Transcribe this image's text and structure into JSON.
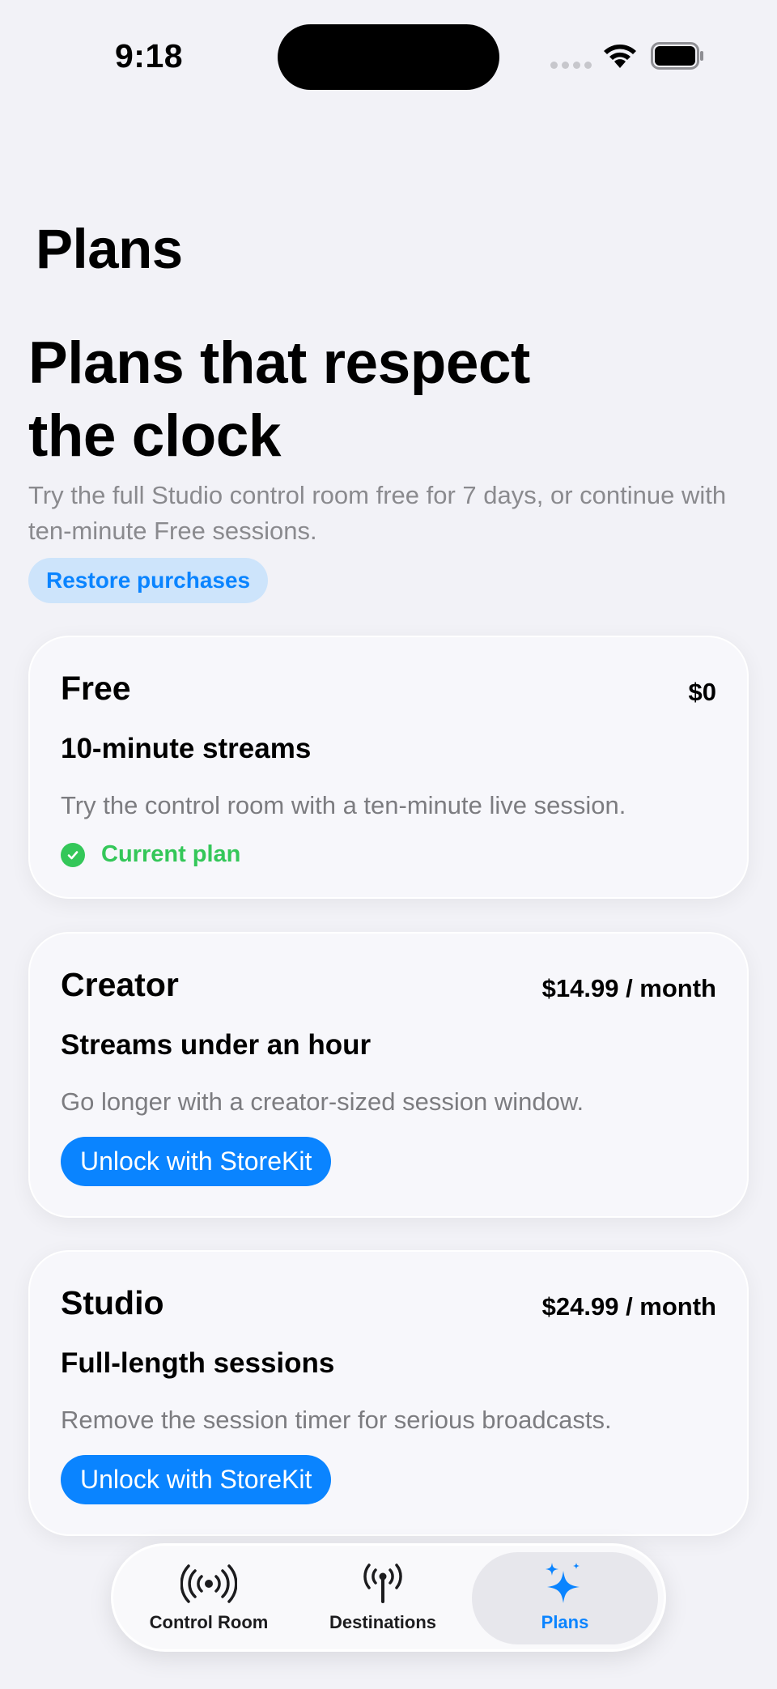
{
  "status_bar": {
    "time": "9:18"
  },
  "nav": {
    "title": "Plans"
  },
  "hero": {
    "title": "Plans that respect the clock",
    "subtitle": "Try the full Studio control room free for 7 days, or continue with ten-minute Free sessions.",
    "restore_label": "Restore purchases"
  },
  "plans": [
    {
      "name": "Free",
      "price": "$0",
      "headline": "10-minute streams",
      "description": "Try the control room with a ten-minute live session.",
      "status": "Current plan"
    },
    {
      "name": "Creator",
      "price": "$14.99 / month",
      "headline": "Streams under an hour",
      "description": "Go longer with a creator-sized session window.",
      "action": "Unlock with StoreKit"
    },
    {
      "name": "Studio",
      "price": "$24.99 / month",
      "headline": "Full-length sessions",
      "description": "Remove the session timer for serious broadcasts.",
      "action": "Unlock with StoreKit"
    }
  ],
  "tabs": [
    {
      "label": "Control Room",
      "icon": "broadcast-icon"
    },
    {
      "label": "Destinations",
      "icon": "antenna-icon"
    },
    {
      "label": "Plans",
      "icon": "sparkles-icon",
      "active": true
    }
  ],
  "colors": {
    "accent": "#0a84ff",
    "success": "#34c759",
    "background": "#f2f2f7"
  }
}
